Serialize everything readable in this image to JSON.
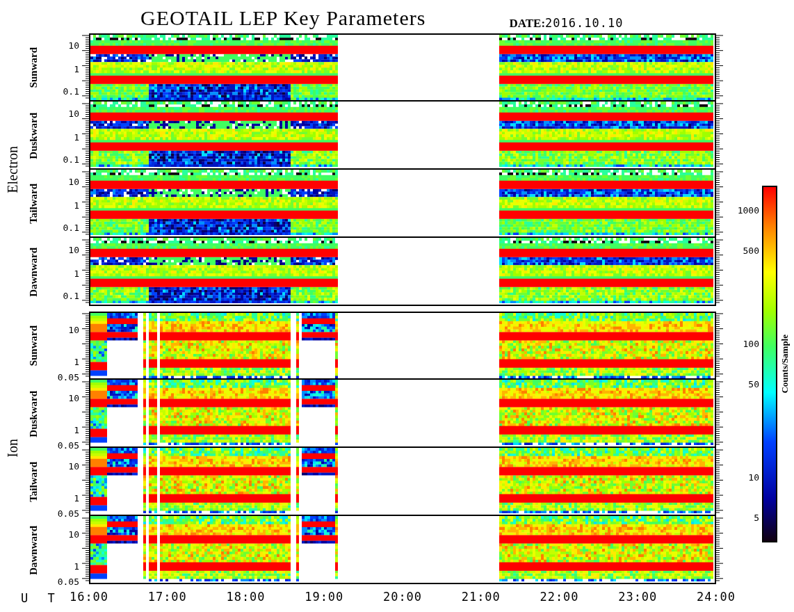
{
  "title": "GEOTAIL LEP Key Parameters",
  "date": {
    "label": "DATE:",
    "value": "2016.10.10"
  },
  "groups": [
    {
      "label": "Electron",
      "kind": "electron",
      "panels": [
        {
          "label": "Sunward",
          "yticks": [
            "10",
            "1",
            "0.1"
          ]
        },
        {
          "label": "Duskward",
          "yticks": [
            "10",
            "1",
            "0.1"
          ]
        },
        {
          "label": "Tailward",
          "yticks": [
            "10",
            "1",
            "0.1"
          ]
        },
        {
          "label": "Dawnward",
          "yticks": [
            "10",
            "1",
            "0.1"
          ]
        }
      ]
    },
    {
      "label": "Ion",
      "kind": "ion",
      "panels": [
        {
          "label": "Sunward",
          "yticks": [
            "10",
            "1",
            "0.05"
          ]
        },
        {
          "label": "Duskward",
          "yticks": [
            "10",
            "1",
            "0.05"
          ]
        },
        {
          "label": "Tailward",
          "yticks": [
            "10",
            "1",
            "0.05"
          ]
        },
        {
          "label": "Dawnward",
          "yticks": [
            "10",
            "1",
            "0.05"
          ]
        }
      ]
    }
  ],
  "time_axis": {
    "label": "U T",
    "ticks": [
      "16:00",
      "17:00",
      "18:00",
      "19:00",
      "20:00",
      "21:00",
      "22:00",
      "23:00",
      "24:00"
    ]
  },
  "colorbar": {
    "label": "Counts/Sample",
    "ticks": [
      "1000",
      "500",
      "100",
      "50",
      "10",
      "5"
    ]
  }
}
